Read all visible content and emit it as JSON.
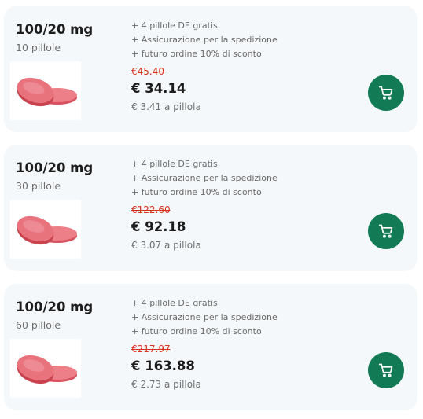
{
  "offers": [
    {
      "dose": "100/20 mg",
      "quantity": "10 pillole",
      "features": [
        "+ 4 pillole DE gratis",
        "+ Assicurazione per la spedizione",
        "+ futuro ordine 10% di sconto"
      ],
      "old_price": "€45.40",
      "price": "€ 34.14",
      "per_pill": "€ 3.41 a pillola",
      "cart_icon": "cart-icon"
    },
    {
      "dose": "100/20 mg",
      "quantity": "30 pillole",
      "features": [
        "+ 4 pillole DE gratis",
        "+ Assicurazione per la spedizione",
        "+ futuro ordine 10% di sconto"
      ],
      "old_price": "€122.60",
      "price": "€ 92.18",
      "per_pill": "€ 3.07 a pillola",
      "cart_icon": "cart-icon"
    },
    {
      "dose": "100/20 mg",
      "quantity": "60 pillole",
      "features": [
        "+ 4 pillole DE gratis",
        "+ Assicurazione per la spedizione",
        "+ futuro ordine 10% di sconto"
      ],
      "old_price": "€217.97",
      "price": "€ 163.88",
      "per_pill": "€ 2.73 a pillola",
      "cart_icon": "cart-icon"
    }
  ],
  "colors": {
    "card_bg": "#f5f8fa",
    "accent_button": "#127a55",
    "old_price": "#d9321f",
    "pill": "#e36a74"
  }
}
